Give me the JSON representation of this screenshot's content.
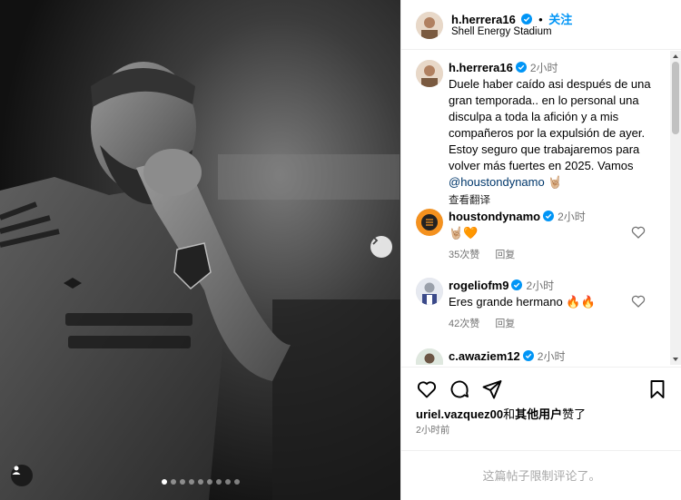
{
  "post": {
    "carousel_dots": 9,
    "active_dot": 0
  },
  "header": {
    "username": "h.herrera16",
    "follow_label": "关注",
    "separator": "•",
    "location": "Shell Energy Stadium"
  },
  "caption": {
    "username": "h.herrera16",
    "time": "2小时",
    "text": "Duele haber caído asi después de una gran temporada.. en lo personal una disculpa a toda la afición y a mis compañeros por la expulsión de ayer. Estoy seguro que trabajaremos para volver más fuertes en 2025. Vamos ",
    "mention": "@houstondynamo",
    "emoji": "🤘🏼",
    "translate_label": "查看翻译"
  },
  "comments": [
    {
      "username": "houstondynamo",
      "time": "2小时",
      "text": "🤘🏼🧡",
      "likes": "35次赞",
      "reply": "回复"
    },
    {
      "username": "rogeliofm9",
      "time": "2小时",
      "text": "Eres grande hermano 🔥🔥",
      "likes": "42次赞",
      "reply": "回复"
    },
    {
      "username": "c.awaziem12",
      "time": "2小时",
      "text": "",
      "likes": "",
      "reply": ""
    }
  ],
  "footer": {
    "liked_by_user": "uriel.vazquez00",
    "liked_by_and": "和",
    "liked_by_others": "其他用户",
    "liked_by_suffix": "赞了",
    "posted_time": "2小时前",
    "comments_limited": "这篇帖子限制评论了。"
  },
  "colors": {
    "accent": "#0095f6",
    "muted": "#737373",
    "mention": "#00376b",
    "verified": "#0095f6",
    "dynamo_orange": "#f4911e"
  }
}
